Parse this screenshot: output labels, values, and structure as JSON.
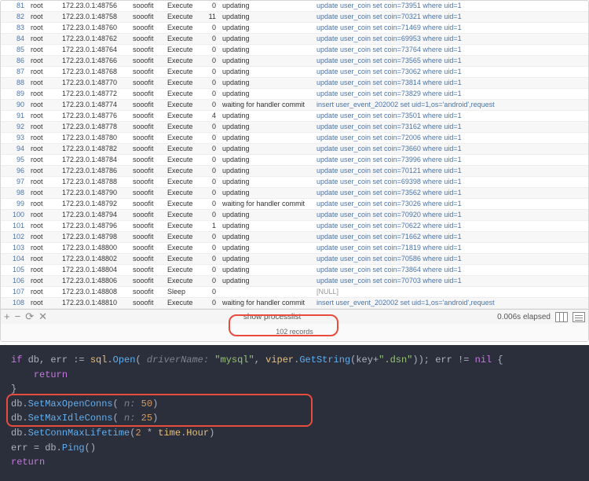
{
  "table": {
    "rows": [
      {
        "id": "81",
        "user": "root",
        "host": "172.23.0.1:48756",
        "db": "sooofit",
        "cmd": "Execute",
        "time": "0",
        "state": "updating",
        "info": "update user_coin set coin=73951 where uid=1"
      },
      {
        "id": "82",
        "user": "root",
        "host": "172.23.0.1:48758",
        "db": "sooofit",
        "cmd": "Execute",
        "time": "11",
        "state": "updating",
        "info": "update user_coin set coin=70321 where uid=1"
      },
      {
        "id": "83",
        "user": "root",
        "host": "172.23.0.1:48760",
        "db": "sooofit",
        "cmd": "Execute",
        "time": "0",
        "state": "updating",
        "info": "update user_coin set coin=71469 where uid=1"
      },
      {
        "id": "84",
        "user": "root",
        "host": "172.23.0.1:48762",
        "db": "sooofit",
        "cmd": "Execute",
        "time": "0",
        "state": "updating",
        "info": "update user_coin set coin=69953 where uid=1"
      },
      {
        "id": "85",
        "user": "root",
        "host": "172.23.0.1:48764",
        "db": "sooofit",
        "cmd": "Execute",
        "time": "0",
        "state": "updating",
        "info": "update user_coin set coin=73764 where uid=1"
      },
      {
        "id": "86",
        "user": "root",
        "host": "172.23.0.1:48766",
        "db": "sooofit",
        "cmd": "Execute",
        "time": "0",
        "state": "updating",
        "info": "update user_coin set coin=73565 where uid=1"
      },
      {
        "id": "87",
        "user": "root",
        "host": "172.23.0.1:48768",
        "db": "sooofit",
        "cmd": "Execute",
        "time": "0",
        "state": "updating",
        "info": "update user_coin set coin=73062 where uid=1"
      },
      {
        "id": "88",
        "user": "root",
        "host": "172.23.0.1:48770",
        "db": "sooofit",
        "cmd": "Execute",
        "time": "0",
        "state": "updating",
        "info": "update user_coin set coin=73814 where uid=1"
      },
      {
        "id": "89",
        "user": "root",
        "host": "172.23.0.1:48772",
        "db": "sooofit",
        "cmd": "Execute",
        "time": "0",
        "state": "updating",
        "info": "update user_coin set coin=73829 where uid=1"
      },
      {
        "id": "90",
        "user": "root",
        "host": "172.23.0.1:48774",
        "db": "sooofit",
        "cmd": "Execute",
        "time": "0",
        "state": "waiting for handler commit",
        "info": "insert user_event_202002 set uid=1,os='android',request"
      },
      {
        "id": "91",
        "user": "root",
        "host": "172.23.0.1:48776",
        "db": "sooofit",
        "cmd": "Execute",
        "time": "4",
        "state": "updating",
        "info": "update user_coin set coin=73501 where uid=1"
      },
      {
        "id": "92",
        "user": "root",
        "host": "172.23.0.1:48778",
        "db": "sooofit",
        "cmd": "Execute",
        "time": "0",
        "state": "updating",
        "info": "update user_coin set coin=73162 where uid=1"
      },
      {
        "id": "93",
        "user": "root",
        "host": "172.23.0.1:48780",
        "db": "sooofit",
        "cmd": "Execute",
        "time": "0",
        "state": "updating",
        "info": "update user_coin set coin=72006 where uid=1"
      },
      {
        "id": "94",
        "user": "root",
        "host": "172.23.0.1:48782",
        "db": "sooofit",
        "cmd": "Execute",
        "time": "0",
        "state": "updating",
        "info": "update user_coin set coin=73660 where uid=1"
      },
      {
        "id": "95",
        "user": "root",
        "host": "172.23.0.1:48784",
        "db": "sooofit",
        "cmd": "Execute",
        "time": "0",
        "state": "updating",
        "info": "update user_coin set coin=73996 where uid=1"
      },
      {
        "id": "96",
        "user": "root",
        "host": "172.23.0.1:48786",
        "db": "sooofit",
        "cmd": "Execute",
        "time": "0",
        "state": "updating",
        "info": "update user_coin set coin=70121 where uid=1"
      },
      {
        "id": "97",
        "user": "root",
        "host": "172.23.0.1:48788",
        "db": "sooofit",
        "cmd": "Execute",
        "time": "0",
        "state": "updating",
        "info": "update user_coin set coin=69398 where uid=1"
      },
      {
        "id": "98",
        "user": "root",
        "host": "172.23.0.1:48790",
        "db": "sooofit",
        "cmd": "Execute",
        "time": "0",
        "state": "updating",
        "info": "update user_coin set coin=73562 where uid=1"
      },
      {
        "id": "99",
        "user": "root",
        "host": "172.23.0.1:48792",
        "db": "sooofit",
        "cmd": "Execute",
        "time": "0",
        "state": "waiting for handler commit",
        "info": "update user_coin set coin=73026 where uid=1"
      },
      {
        "id": "100",
        "user": "root",
        "host": "172.23.0.1:48794",
        "db": "sooofit",
        "cmd": "Execute",
        "time": "0",
        "state": "updating",
        "info": "update user_coin set coin=70920 where uid=1"
      },
      {
        "id": "101",
        "user": "root",
        "host": "172.23.0.1:48796",
        "db": "sooofit",
        "cmd": "Execute",
        "time": "1",
        "state": "updating",
        "info": "update user_coin set coin=70622 where uid=1"
      },
      {
        "id": "102",
        "user": "root",
        "host": "172.23.0.1:48798",
        "db": "sooofit",
        "cmd": "Execute",
        "time": "0",
        "state": "updating",
        "info": "update user_coin set coin=71662 where uid=1"
      },
      {
        "id": "103",
        "user": "root",
        "host": "172.23.0.1:48800",
        "db": "sooofit",
        "cmd": "Execute",
        "time": "0",
        "state": "updating",
        "info": "update user_coin set coin=71819 where uid=1"
      },
      {
        "id": "104",
        "user": "root",
        "host": "172.23.0.1:48802",
        "db": "sooofit",
        "cmd": "Execute",
        "time": "0",
        "state": "updating",
        "info": "update user_coin set coin=70586 where uid=1"
      },
      {
        "id": "105",
        "user": "root",
        "host": "172.23.0.1:48804",
        "db": "sooofit",
        "cmd": "Execute",
        "time": "0",
        "state": "updating",
        "info": "update user_coin set coin=73864 where uid=1"
      },
      {
        "id": "106",
        "user": "root",
        "host": "172.23.0.1:48806",
        "db": "sooofit",
        "cmd": "Execute",
        "time": "0",
        "state": "updating",
        "info": "update user_coin set coin=70703 where uid=1"
      },
      {
        "id": "107",
        "user": "root",
        "host": "172.23.0.1:48808",
        "db": "sooofit",
        "cmd": "Sleep",
        "time": "0",
        "state": "",
        "info": "[NULL]"
      },
      {
        "id": "108",
        "user": "root",
        "host": "172.23.0.1:48810",
        "db": "sooofit",
        "cmd": "Execute",
        "time": "0",
        "state": "waiting for handler commit",
        "info": "insert user_event_202002 set uid=1,os='android',request"
      }
    ]
  },
  "footer": {
    "add": "+",
    "remove": "−",
    "close": "✕",
    "refresh": "⟳",
    "query": "show processlist",
    "elapsed": "0.006s elapsed",
    "records": "102 records"
  },
  "code": {
    "if_kw": "if",
    "db_var": "db",
    "err_var": "err",
    "assign": ":=",
    "sql_pkg": "sql",
    "open_fn": "Open",
    "param_driver": "driverName:",
    "mysql": "\"mysql\"",
    "viper_pkg": "viper",
    "getstr_fn": "GetString",
    "key_var": "key",
    "dsn": "\".dsn\"",
    "neq": "!=",
    "nil": "nil",
    "return": "return",
    "setmaxopen": "SetMaxOpenConns",
    "setmaxidle": "SetMaxIdleConns",
    "setlife": "SetConnMaxLifetime",
    "param_n": "n:",
    "n50": "50",
    "n25": "25",
    "two": "2",
    "time_pkg": "time",
    "hour": "Hour",
    "ping": "Ping",
    "eq": "="
  }
}
